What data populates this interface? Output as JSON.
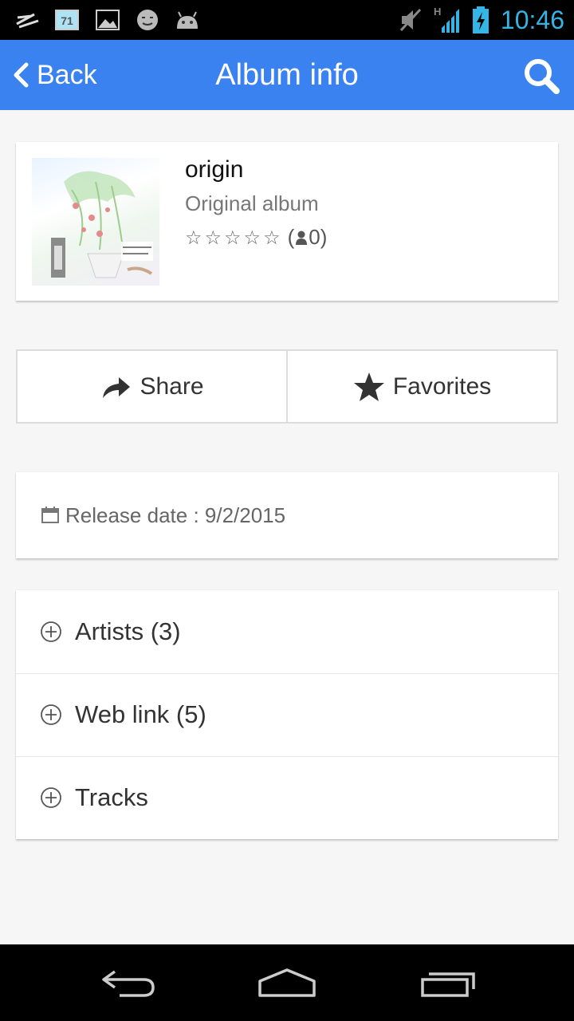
{
  "status_bar": {
    "time": "10:46",
    "notification_badge": "71",
    "network_type": "H",
    "icons": [
      "signature-icon",
      "calendar-notification-icon",
      "image-icon",
      "smiley-icon",
      "android-icon",
      "mute-icon",
      "signal-icon",
      "battery-charging-icon"
    ]
  },
  "app_bar": {
    "back_label": "Back",
    "title": "Album info",
    "search_icon": "search-icon",
    "color": "#3b82f1"
  },
  "album": {
    "title": "origin",
    "type": "Original album",
    "stars": "☆☆☆☆☆",
    "rating_count_open": "(",
    "rating_count": "0)"
  },
  "actions": {
    "share_label": "Share",
    "favorites_label": "Favorites"
  },
  "release": {
    "text": "Release date : 9/2/2015"
  },
  "sections": [
    {
      "label": "Artists (3)"
    },
    {
      "label": "Web link (5)"
    },
    {
      "label": "Tracks"
    }
  ],
  "nav_bar": {
    "icons": [
      "back-nav-icon",
      "home-nav-icon",
      "recents-nav-icon"
    ]
  }
}
